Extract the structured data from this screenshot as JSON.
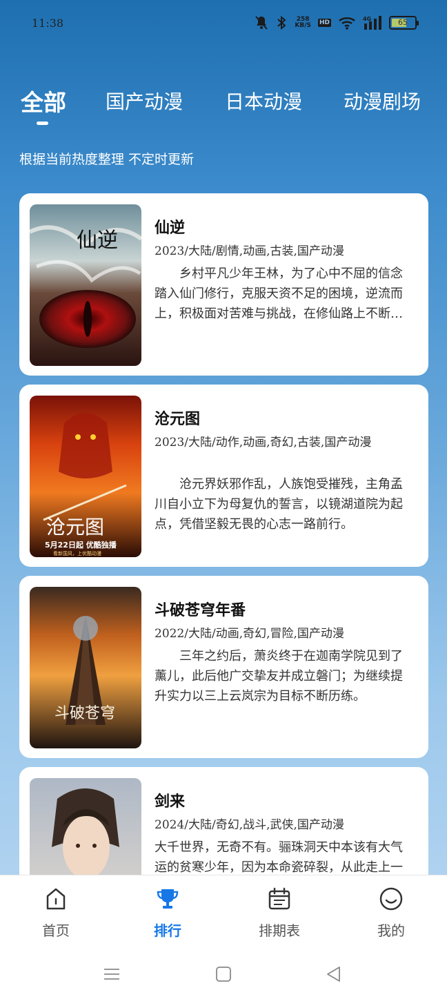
{
  "status_bar": {
    "time": "11:38",
    "net_speed_value": "258",
    "net_speed_unit": "KB/S",
    "hd": "HD",
    "signal_label": "4G",
    "battery": "65",
    "battery_fraction": 0.65,
    "battery_color": "#b5c86a",
    "icons": [
      "mute-icon",
      "bluetooth-icon",
      "wifi-icon",
      "signal-icon",
      "battery-icon"
    ]
  },
  "tabs": [
    {
      "label": "全部",
      "active": true
    },
    {
      "label": "国产动漫",
      "active": false
    },
    {
      "label": "日本动漫",
      "active": false
    },
    {
      "label": "动漫剧场",
      "active": false
    }
  ],
  "subtitle": "根据当前热度整理 不定时更新",
  "cards": [
    {
      "title": "仙逆",
      "meta": "2023/大陆/剧情,动画,古装,国产动漫",
      "description": "乡村平凡少年王林，为了心中不屈的信念踏入仙门修行，克服天资不足的困境，逆流而上，积极面对苦难与挑战，在修仙路上不断成长。",
      "poster_text": "仙逆"
    },
    {
      "title": "沧元图",
      "meta": "2023/大陆/动作,动画,奇幻,古装,国产动漫",
      "description": "沧元界妖邪作乱，人族饱受摧残，主角孟川自小立下为母复仇的誓言，以镜湖道院为起点，凭借坚毅无畏的心志一路前行。",
      "poster_text": "沧元图",
      "poster_caption": "5月22日起 优酷独播",
      "poster_sub": "看新国风，上优酷动漫"
    },
    {
      "title": "斗破苍穹年番",
      "meta": "2022/大陆/动画,奇幻,冒险,国产动漫",
      "description": "三年之约后，萧炎终于在迦南学院见到了薰儿，此后他广交挚友并成立磐门；为继续提升实力以三上云岚宗为目标不断历练。",
      "poster_text": "斗破苍穹"
    },
    {
      "title": "剑来",
      "meta": "2024/大陆/奇幻,战斗,武侠,国产动漫",
      "description": "大千世界，无奇不有。骊珠洞天中本该有大气运的贫寒少年，因为本命瓷碎裂，从此走上一条截然不同的道路。"
    }
  ],
  "bottom_nav": [
    {
      "label": "首页",
      "icon": "home-icon",
      "active": false
    },
    {
      "label": "排行",
      "icon": "trophy-icon",
      "active": true
    },
    {
      "label": "排期表",
      "icon": "calendar-icon",
      "active": false
    },
    {
      "label": "我的",
      "icon": "smiley-icon",
      "active": false
    }
  ],
  "system_nav": [
    "menu-icon",
    "home-square-icon",
    "back-triangle-icon"
  ],
  "colors": {
    "accent": "#1677e6",
    "tab_text": "#ffffff",
    "card_bg": "#ffffff"
  }
}
